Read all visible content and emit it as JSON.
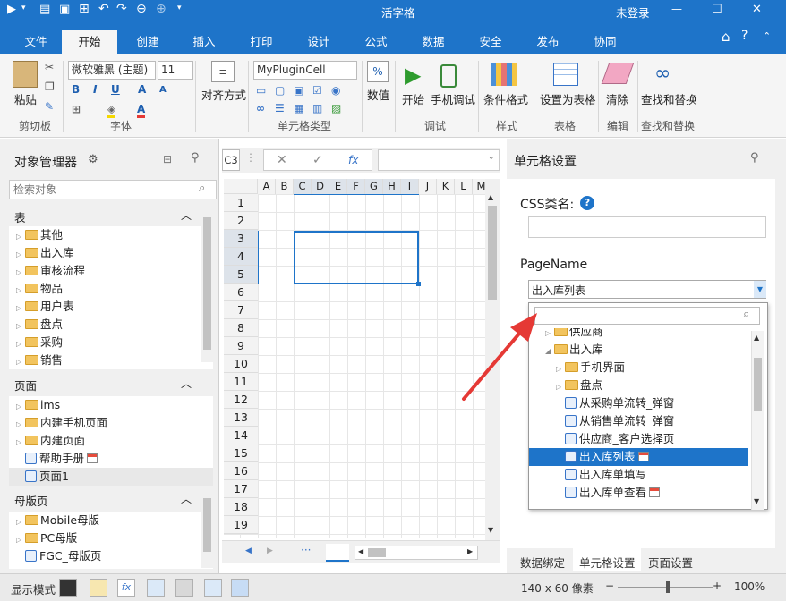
{
  "titlebar": {
    "title": "活字格",
    "user": "未登录",
    "minimize": "—",
    "maximize": "☐",
    "close": "✕"
  },
  "ribbon_tabs": [
    {
      "label": "文件"
    },
    {
      "label": "开始"
    },
    {
      "label": "创建"
    },
    {
      "label": "插入"
    },
    {
      "label": "打印"
    },
    {
      "label": "设计"
    },
    {
      "label": "公式"
    },
    {
      "label": "数据"
    },
    {
      "label": "安全"
    },
    {
      "label": "发布"
    },
    {
      "label": "协同"
    }
  ],
  "ribbon": {
    "paste": "粘贴",
    "clipboard": "剪切板",
    "font_name": "微软雅黑 (主题)",
    "font_size": "11",
    "font_group": "字体",
    "align": "对齐方式",
    "celltype_combo": "MyPluginCell",
    "celltype_group": "单元格类型",
    "number": "数值",
    "start": "开始",
    "mobile_debug": "手机调试",
    "debug_group": "调试",
    "cond_format": "条件格式",
    "style_group": "样式",
    "set_table": "设置为表格",
    "table_group": "表格",
    "clear": "清除",
    "edit_group": "编辑",
    "find_replace": "查找和替换",
    "find_group": "查找和替换"
  },
  "object_manager": {
    "title": "对象管理器",
    "search_placeholder": "检索对象",
    "tables_header": "表",
    "tables": [
      "其他",
      "出入库",
      "审核流程",
      "物品",
      "用户表",
      "盘点",
      "采购",
      "销售"
    ],
    "pages_header": "页面",
    "pages": [
      "ims",
      "内建手机页面",
      "内建页面",
      "帮助手册",
      "页面1"
    ],
    "masters_header": "母版页",
    "masters": [
      "Mobile母版",
      "PC母版",
      "FGC_母版页"
    ]
  },
  "formula_bar": {
    "cell_ref": "C3",
    "cancel": "✕",
    "confirm": "✓",
    "fx": "fx"
  },
  "grid": {
    "columns": [
      "A",
      "B",
      "C",
      "D",
      "E",
      "F",
      "G",
      "H",
      "I",
      "J",
      "K",
      "L",
      "M"
    ],
    "rows": [
      "1",
      "2",
      "3",
      "4",
      "5",
      "6",
      "7",
      "8",
      "9",
      "10",
      "11",
      "12",
      "13",
      "14",
      "15",
      "16",
      "17",
      "18",
      "19"
    ],
    "sheet_tabs_more": "···"
  },
  "cell_settings": {
    "title": "单元格设置",
    "css_label": "CSS类名:",
    "css_value": "",
    "pagename_label": "PageName",
    "pagename_value": "出入库列表",
    "dropdown_search_placeholder": "",
    "dropdown_items": [
      {
        "label": "供应商",
        "indent": 1,
        "kind": "folder",
        "arrow": "▷"
      },
      {
        "label": "出入库",
        "indent": 1,
        "kind": "folder",
        "arrow": "◢"
      },
      {
        "label": "手机界面",
        "indent": 2,
        "kind": "folder",
        "arrow": "▷"
      },
      {
        "label": "盘点",
        "indent": 2,
        "kind": "folder",
        "arrow": "▷"
      },
      {
        "label": "从采购单流转_弹窗",
        "indent": 2,
        "kind": "page",
        "arrow": ""
      },
      {
        "label": "从销售单流转_弹窗",
        "indent": 2,
        "kind": "page",
        "arrow": ""
      },
      {
        "label": "供应商_客户选择页",
        "indent": 2,
        "kind": "page",
        "arrow": ""
      },
      {
        "label": "出入库列表",
        "indent": 2,
        "kind": "page-tag",
        "arrow": "",
        "selected": true
      },
      {
        "label": "出入库单填写",
        "indent": 2,
        "kind": "page",
        "arrow": ""
      },
      {
        "label": "出入库单查看",
        "indent": 2,
        "kind": "page-tag",
        "arrow": ""
      }
    ],
    "bottom_tabs": [
      "数据绑定",
      "单元格设置",
      "页面设置"
    ]
  },
  "statusbar": {
    "display_mode": "显示模式",
    "size": "140 x 60 像素",
    "zoom": "100%"
  },
  "colors": {
    "accent": "#1e74c9",
    "selection": "#1e74c9",
    "arrow": "#e53935"
  }
}
